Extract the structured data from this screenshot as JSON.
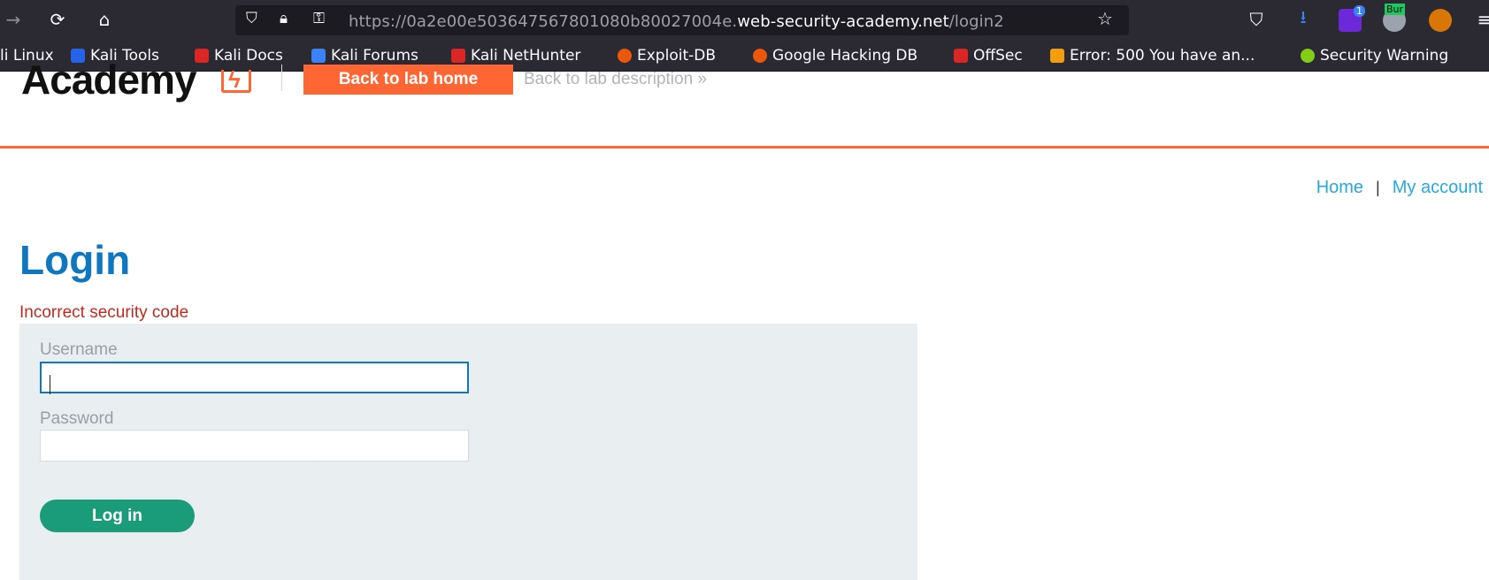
{
  "browser": {
    "url_prefix": "https://0a2e00e503647567801080b80027004e.",
    "url_domain": "web-security-academy.net",
    "url_path": "/login2",
    "extension_badge": "1",
    "burp_label": "Bur"
  },
  "bookmarks": [
    {
      "label": "li Linux",
      "color": "#3b82f6"
    },
    {
      "label": "Kali Tools",
      "color": "#2563eb"
    },
    {
      "label": "Kali Docs",
      "color": "#dc2626"
    },
    {
      "label": "Kali Forums",
      "color": "#3b82f6"
    },
    {
      "label": "Kali NetHunter",
      "color": "#dc2626"
    },
    {
      "label": "Exploit-DB",
      "color": "#ea580c"
    },
    {
      "label": "Google Hacking DB",
      "color": "#ea580c"
    },
    {
      "label": "OffSec",
      "color": "#dc2626"
    },
    {
      "label": "Error: 500 You have an...",
      "color": "#f59e0b"
    },
    {
      "label": "Security Warning",
      "color": "#84cc16"
    }
  ],
  "header": {
    "logo_text": "Academy",
    "back_home": "Back to lab home",
    "back_description": "Back to lab description »"
  },
  "nav": {
    "home": "Home",
    "separator": "|",
    "my_account": "My account"
  },
  "login": {
    "title": "Login",
    "error": "Incorrect security code",
    "username_label": "Username",
    "username_value": "",
    "password_label": "Password",
    "password_value": "",
    "button": "Log in"
  },
  "colors": {
    "accent": "#ff6633",
    "title_blue": "#0e77c0",
    "link_blue": "#29a8dd",
    "error_red": "#c12a1f",
    "button_green": "#1a9c7a"
  }
}
